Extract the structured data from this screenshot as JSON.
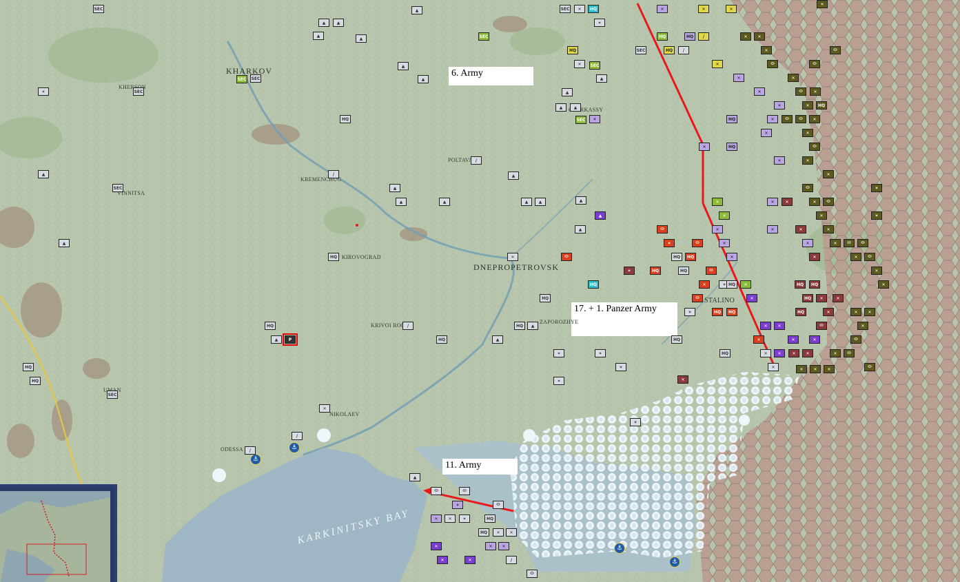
{
  "map": {
    "labels": {
      "army6": "6. Army",
      "army17": "17. + 1. Panzer Army",
      "army11": "11. Army"
    },
    "places": {
      "dnepropetrovsk": "DNEPROPETROVSK",
      "stalino": "STALINO",
      "krivoi_rog": "KRIVOI ROG",
      "zaporozhye": "ZAPOROZHYE",
      "kirovograd": "KIROVOGRAD",
      "poltava": "POLTAVA",
      "nikolaev": "NIKOLAEV",
      "kremenchug": "KREMENCHUG",
      "cherkassy": "CHERKASSY",
      "uman": "UMAN",
      "vinnitsa": "VINNITSA",
      "odessa": "ODESSA",
      "kharkov": "KHARKOV",
      "kherson": "KHERSON"
    },
    "sea": "KARKINITSKY BAY",
    "colors": {
      "front_line": "#e8181c",
      "axis_infantry": "#d9dbe3",
      "axis_security": "#8cbc3a",
      "axis_allied": "#e0d84a",
      "soviet_line": "#5c5a1e",
      "soviet_shock": "#7a3fd0",
      "soviet_tank": "#d8401f",
      "land": "#b9c6ae",
      "sea_water": "#9fb6c4",
      "soviet_territory": "#b89f94"
    },
    "unit_symbols": {
      "infantry": "✕",
      "mountain": "▲",
      "headquarters": "HQ",
      "security": "SEC",
      "panzer": "⬭",
      "airborne": "✶",
      "cavalry": "/",
      "special": "P"
    }
  }
}
